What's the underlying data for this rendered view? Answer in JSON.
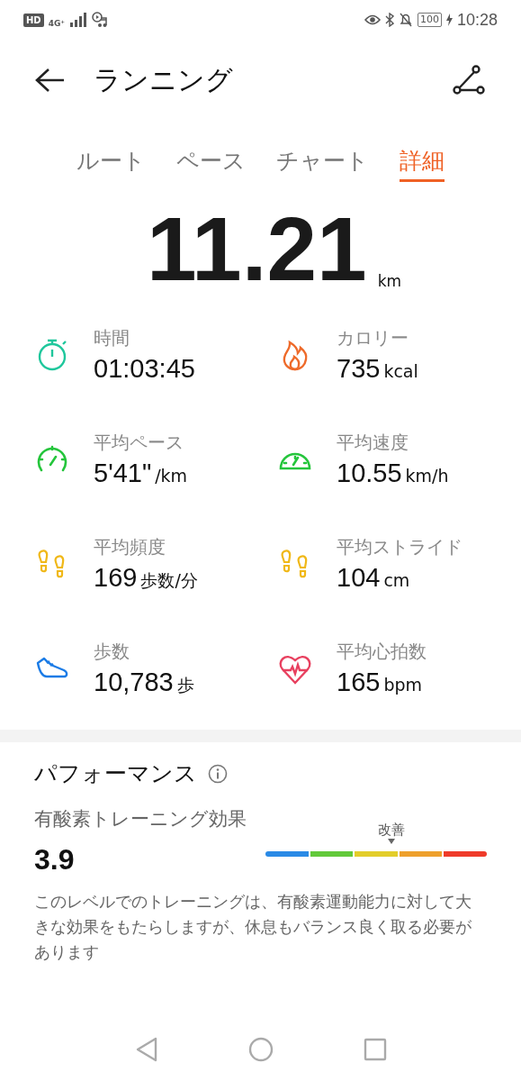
{
  "status_bar": {
    "hd": "HD",
    "network": "4G⁺",
    "battery": "100",
    "time": "10:28"
  },
  "header": {
    "title": "ランニング"
  },
  "tabs": [
    {
      "label": "ルート",
      "selected": false
    },
    {
      "label": "ペース",
      "selected": false
    },
    {
      "label": "チャート",
      "selected": false
    },
    {
      "label": "詳細",
      "selected": true
    }
  ],
  "distance": {
    "value": "11.21",
    "unit": "km"
  },
  "stats": [
    {
      "kind": "timer",
      "label": "時間",
      "value": "01:03:45"
    },
    {
      "kind": "calories",
      "label": "カロリー",
      "value": "735",
      "unit": "kcal"
    },
    {
      "kind": "pace",
      "label": "平均ペース",
      "value": "5'41\"",
      "unit": "/km"
    },
    {
      "kind": "speed",
      "label": "平均速度",
      "value": "10.55",
      "unit": "km/h"
    },
    {
      "kind": "cadence",
      "label": "平均頻度",
      "value": "169",
      "unit": "歩数/分"
    },
    {
      "kind": "stride",
      "label": "平均ストライド",
      "value": "104",
      "unit": "cm"
    },
    {
      "kind": "steps",
      "label": "歩数",
      "value": "10,783",
      "unit": "歩"
    },
    {
      "kind": "heart",
      "label": "平均心拍数",
      "value": "165",
      "unit": "bpm"
    }
  ],
  "performance": {
    "title": "パフォーマンス",
    "metric_label": "有酸素トレーニング効果",
    "score": "3.9",
    "gauge": {
      "marker_label": "改善",
      "segments": [
        {
          "color": "#2a8ae6"
        },
        {
          "color": "#62c93a"
        },
        {
          "color": "#e3cd2a"
        },
        {
          "color": "#eea02c"
        },
        {
          "color": "#ef3b2a"
        }
      ]
    },
    "description": "このレベルでのトレーニングは、有酸素運動能力に対して大きな効果をもたらしますが、休息もバランス良く取る必要があります"
  }
}
